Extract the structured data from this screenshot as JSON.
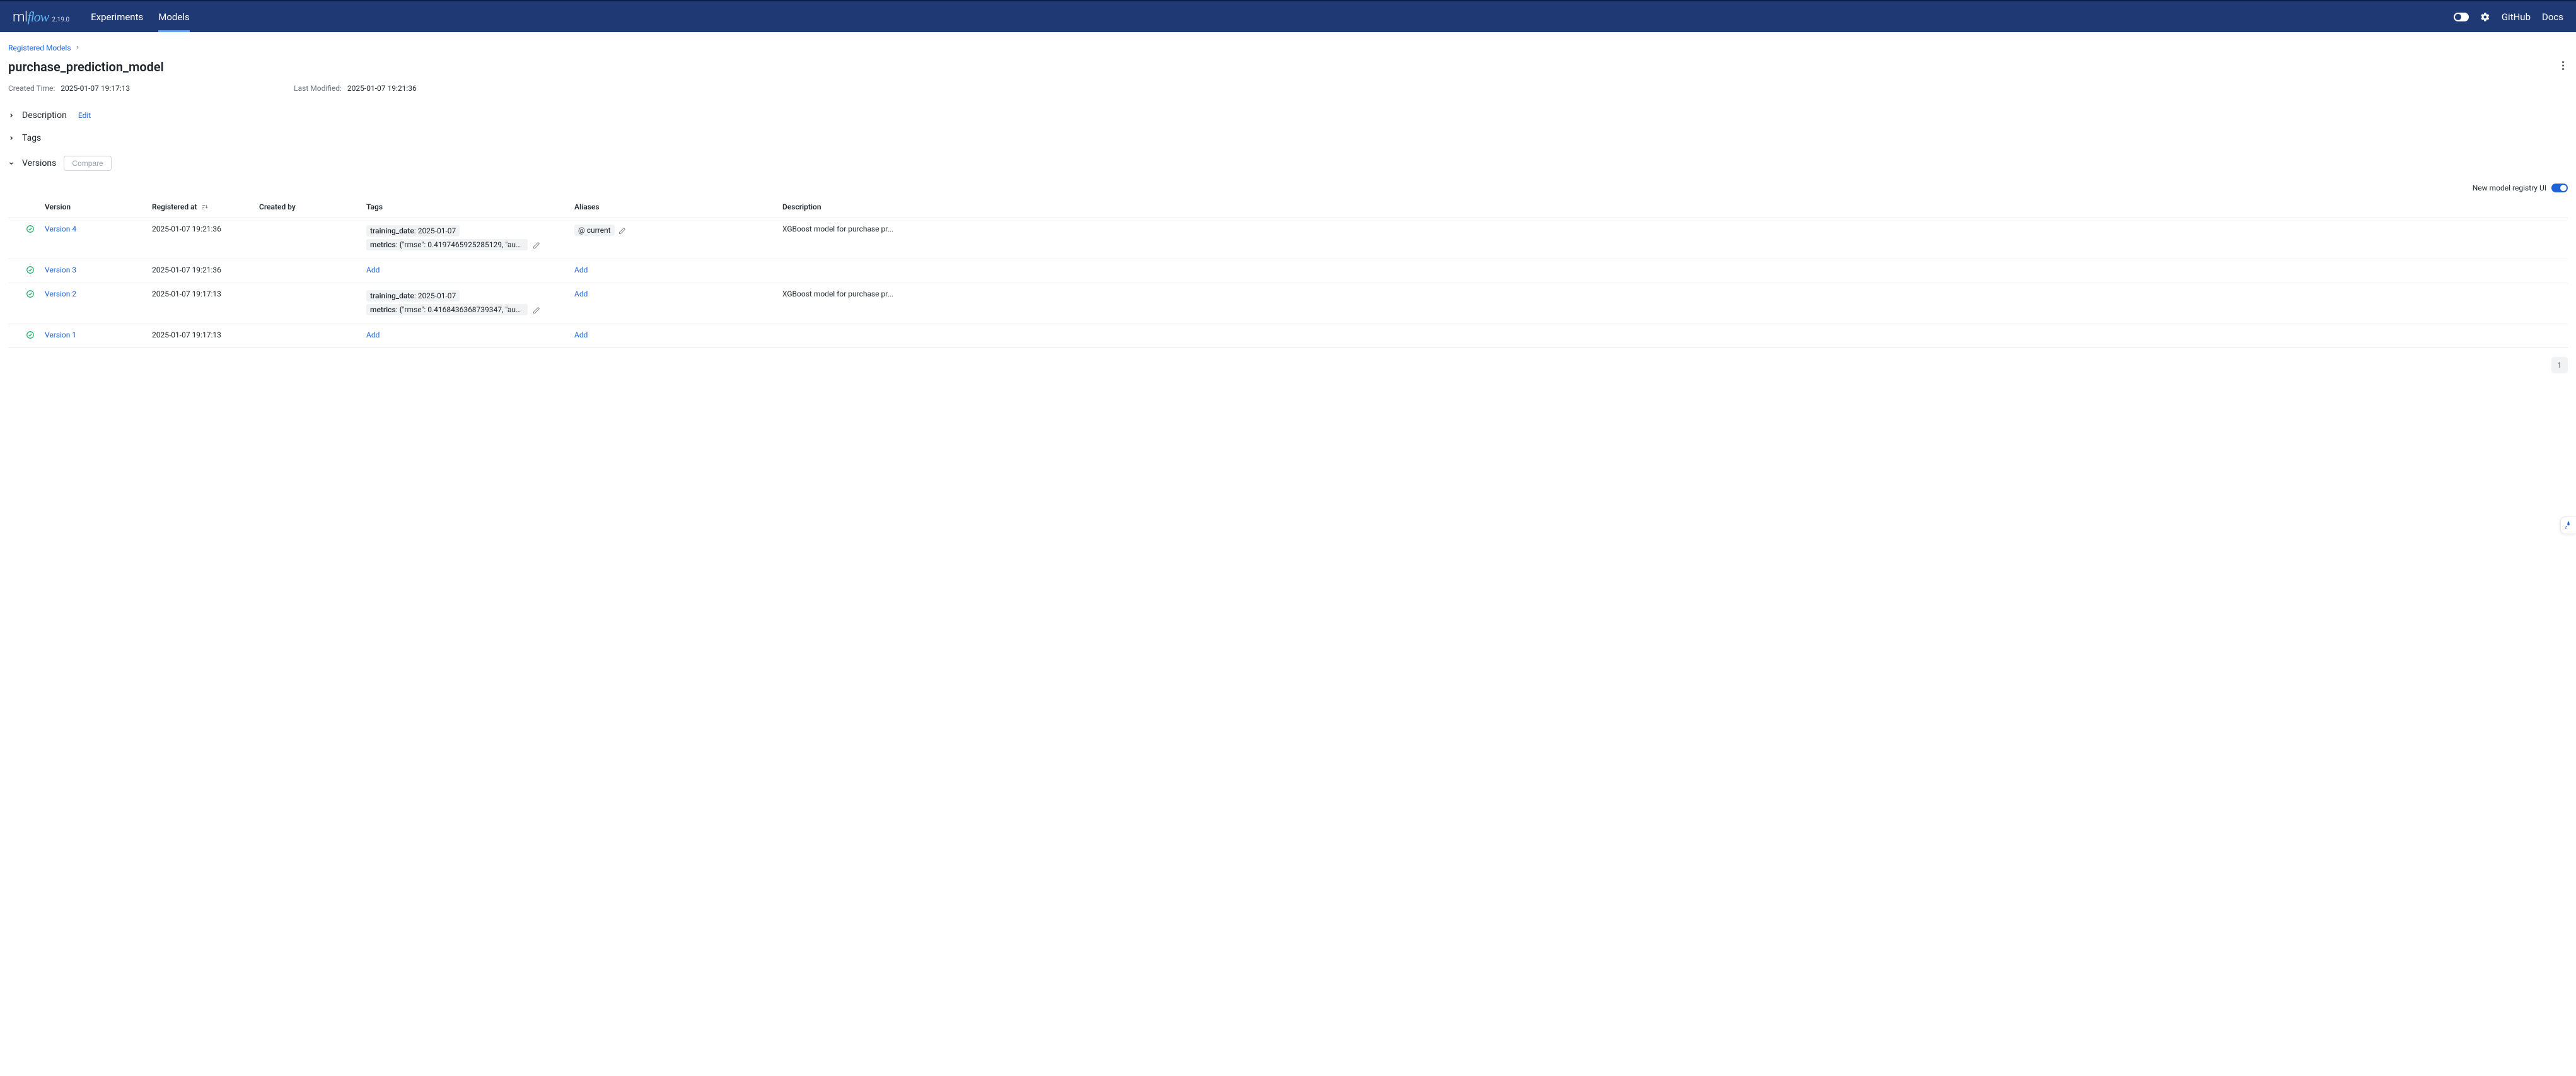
{
  "header": {
    "logo_ml": "ml",
    "logo_flow": "flow",
    "version": "2.19.0",
    "nav": {
      "experiments": "Experiments",
      "models": "Models"
    },
    "links": {
      "github": "GitHub",
      "docs": "Docs"
    }
  },
  "breadcrumb": {
    "root": "Registered Models"
  },
  "model": {
    "name": "purchase_prediction_model",
    "created_label": "Created Time:",
    "created_value": "2025-01-07 19:17:13",
    "modified_label": "Last Modified:",
    "modified_value": "2025-01-07 19:21:36"
  },
  "sections": {
    "description": "Description",
    "edit": "Edit",
    "tags": "Tags",
    "versions": "Versions",
    "compare": "Compare"
  },
  "registry_toggle_label": "New model registry UI",
  "columns": {
    "version": "Version",
    "registered_at": "Registered at",
    "created_by": "Created by",
    "tags": "Tags",
    "aliases": "Aliases",
    "description": "Description"
  },
  "labels": {
    "add": "Add"
  },
  "versions": [
    {
      "name": "Version 4",
      "registered_at": "2025-01-07 19:21:36",
      "created_by": "",
      "tags": [
        {
          "key": "training_date",
          "value": "2025-01-07"
        },
        {
          "key": "metrics",
          "value": "{\"rmse\": 0.4197465925285129, \"auc..."
        }
      ],
      "aliases": [
        {
          "label": "@ current"
        }
      ],
      "description": "XGBoost model for purchase pr..."
    },
    {
      "name": "Version 3",
      "registered_at": "2025-01-07 19:21:36",
      "created_by": "",
      "tags": [],
      "aliases": [],
      "description": ""
    },
    {
      "name": "Version 2",
      "registered_at": "2025-01-07 19:17:13",
      "created_by": "",
      "tags": [
        {
          "key": "training_date",
          "value": "2025-01-07"
        },
        {
          "key": "metrics",
          "value": "{\"rmse\": 0.4168436368739347, \"auc..."
        }
      ],
      "aliases": [],
      "description": "XGBoost model for purchase pr..."
    },
    {
      "name": "Version 1",
      "registered_at": "2025-01-07 19:17:13",
      "created_by": "",
      "tags": [],
      "aliases": [],
      "description": ""
    }
  ],
  "pagination": {
    "current": "1"
  }
}
